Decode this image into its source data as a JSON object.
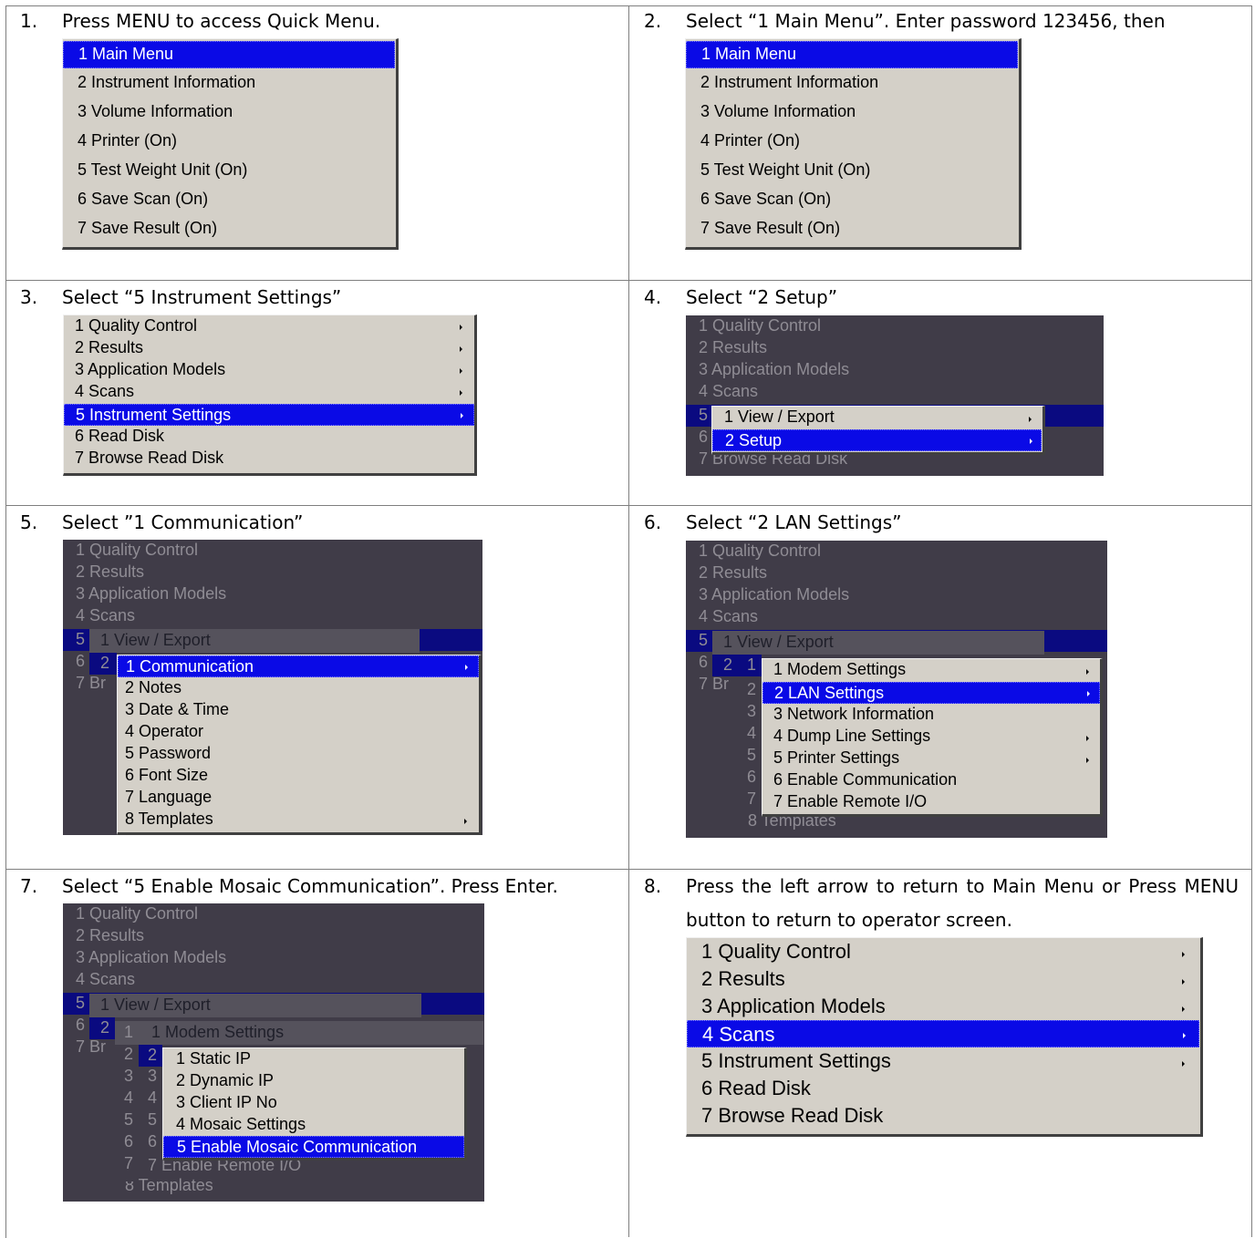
{
  "steps": [
    {
      "num": "1.",
      "text": "Press MENU to access Quick Menu."
    },
    {
      "num": "2.",
      "text": "Select “1 Main Menu”. Enter password 123456, then"
    },
    {
      "num": "3.",
      "text": "Select “5 Instrument Settings”"
    },
    {
      "num": "4.",
      "text": "Select “2 Setup”"
    },
    {
      "num": "5.",
      "text": "Select ”1 Communication”"
    },
    {
      "num": "6.",
      "text": "Select “2 LAN Settings”"
    },
    {
      "num": "7.",
      "text": "Select “5 Enable Mosaic Communication”. Press Enter."
    },
    {
      "num": "8.",
      "text": "Press the left arrow to return to Main Menu or Press MENU button to return to operator screen."
    }
  ],
  "quick_menu": [
    "1 Main Menu",
    "2 Instrument Information",
    "3 Volume Information",
    "4 Printer (On)",
    "5 Test Weight Unit (On)",
    "6 Save Scan (On)",
    "7 Save Result (On)"
  ],
  "main_menu": [
    "1 Quality Control",
    "2 Results",
    "3 Application Models",
    "4 Scans",
    "5 Instrument Settings",
    "6 Read Disk",
    "7 Browse Read Disk"
  ],
  "settings_menu": [
    "1 View / Export",
    "2 Setup"
  ],
  "setup_menu": [
    "1 Communication",
    "2 Notes",
    "3 Date & Time",
    "4 Operator",
    "5 Password",
    "6 Font Size",
    "7 Language",
    "8 Templates"
  ],
  "comm_menu": [
    "1 Modem Settings",
    "2 LAN Settings",
    "3 Network Information",
    "4 Dump Line Settings",
    "5 Printer Settings",
    "6 Enable Communication",
    "7 Enable Remote I/O"
  ],
  "lan_menu": [
    "1 Static IP",
    "2 Dynamic IP",
    "3 Client IP No",
    "4 Mosaic Settings",
    "5 Enable Mosaic Communication"
  ],
  "peek": {
    "five": "5",
    "six": "6",
    "seven_br": "7 Br",
    "two": "2",
    "one": "1",
    "templates": "8 Templates",
    "remote": "7 Enable Remote I/O",
    "browse_partial": "7 Browse Read Disk",
    "d2": "2",
    "d3": "3",
    "d4": "4",
    "d5": "5",
    "d6": "6",
    "d7": "7"
  }
}
